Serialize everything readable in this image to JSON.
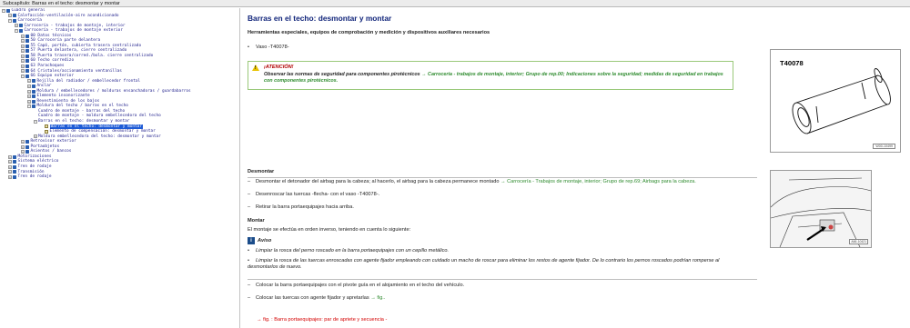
{
  "window": {
    "title": "Subcapítulo: Barras en el techo: desmontar y montar"
  },
  "tree": [
    {
      "indent": 0,
      "exp": "−",
      "icon": "book",
      "label": "Cuadro general"
    },
    {
      "indent": 1,
      "exp": "+",
      "icon": "book",
      "label": "Calefacción-ventilación-aire acondicionado"
    },
    {
      "indent": 1,
      "exp": "−",
      "icon": "book",
      "label": "Carrocería"
    },
    {
      "indent": 2,
      "exp": "+",
      "icon": "book",
      "label": "Carrocería - trabajos de montaje, interior"
    },
    {
      "indent": 2,
      "exp": "−",
      "icon": "book",
      "label": "Carrocería - trabajos de montaje exterior"
    },
    {
      "indent": 3,
      "exp": "+",
      "icon": "book",
      "label": "00 Datos técnicos"
    },
    {
      "indent": 3,
      "exp": "+",
      "icon": "book",
      "label": "50 Carrocería parte delantera"
    },
    {
      "indent": 3,
      "exp": "+",
      "icon": "book",
      "label": "55 Capó, portón, cubierta trasera centralizado"
    },
    {
      "indent": 3,
      "exp": "+",
      "icon": "book",
      "label": "57 Puerta delantera, cierre centralizado"
    },
    {
      "indent": 3,
      "exp": "+",
      "icon": "book",
      "label": "58 Puerta trasera/corred./bola. cierre centralizado"
    },
    {
      "indent": 3,
      "exp": "+",
      "icon": "book",
      "label": "60 Techo corredizo"
    },
    {
      "indent": 3,
      "exp": "+",
      "icon": "book",
      "label": "63 Parachoques"
    },
    {
      "indent": 3,
      "exp": "+",
      "icon": "book",
      "label": "64 Cristales/accionamiento ventanillas"
    },
    {
      "indent": 3,
      "exp": "−",
      "icon": "book",
      "label": "66 Equipo exterior"
    },
    {
      "indent": 4,
      "exp": "+",
      "icon": "book",
      "label": "Rejilla del radiador / embellecedor frontal"
    },
    {
      "indent": 4,
      "exp": "+",
      "icon": "book",
      "label": "Anclar"
    },
    {
      "indent": 4,
      "exp": "+",
      "icon": "book",
      "label": "Moldura / embellecedores / molduras ensanchadoras / guardabarros"
    },
    {
      "indent": 4,
      "exp": "+",
      "icon": "book",
      "label": "Elemento insonorizante"
    },
    {
      "indent": 4,
      "exp": "+",
      "icon": "book",
      "label": "Revestimiento de los bajos"
    },
    {
      "indent": 4,
      "exp": "−",
      "icon": "book",
      "label": "Moldura del techo / barras en el techo"
    },
    {
      "indent": 5,
      "exp": "",
      "icon": "doc",
      "label": "Cuadro de montaje - barras del techo"
    },
    {
      "indent": 5,
      "exp": "",
      "icon": "doc",
      "label": "Cuadro de montaje - moldura embellecedora del techo"
    },
    {
      "indent": 5,
      "exp": "−",
      "icon": "doc",
      "label": "Barras en el techo: desmontar y montar"
    },
    {
      "indent": 6,
      "exp": "",
      "icon": "page",
      "label": "Barras en el techo: desmontar y montar",
      "selected": true
    },
    {
      "indent": 6,
      "exp": "",
      "icon": "page",
      "label": "Elemento de compensación: desmontar y montar"
    },
    {
      "indent": 5,
      "exp": "+",
      "icon": "doc",
      "label": "Moldura embellecedora del techo: desmontar y montar"
    },
    {
      "indent": 3,
      "exp": "+",
      "icon": "book",
      "label": "Retrovisor exterior"
    },
    {
      "indent": 3,
      "exp": "+",
      "icon": "book",
      "label": "Portaobjetos"
    },
    {
      "indent": 3,
      "exp": "+",
      "icon": "book",
      "label": "Asientos / bancos"
    },
    {
      "indent": 1,
      "exp": "+",
      "icon": "book",
      "label": "Motorizaciones"
    },
    {
      "indent": 1,
      "exp": "+",
      "icon": "book",
      "label": "Sistema eléctrico"
    },
    {
      "indent": 1,
      "exp": "+",
      "icon": "book",
      "label": "Tren de rodaje"
    },
    {
      "indent": 1,
      "exp": "+",
      "icon": "book",
      "label": "Transmisión"
    },
    {
      "indent": 1,
      "exp": "+",
      "icon": "book",
      "label": "Tren de rodaje"
    }
  ],
  "doc": {
    "title": "Barras en el techo: desmontar y montar",
    "subtitle": "Herramientas especiales, equipos de comprobación y medición y dispositivos auxiliares necesarios",
    "tool_bullet": "Vaso -T40078-",
    "warning": {
      "title": "¡ATENCIÓN!",
      "text_prefix": "Observar las normas de seguridad para componentes pirotécnicos ",
      "link": "→ Carrocería - trabajos de montaje, interior; Grupo de rep.00; Indicaciones sobre la seguridad; medidas de seguridad en trabajos con componentes pirotécnicos."
    },
    "figure1": {
      "label": "T40078",
      "code": "W00-10499"
    },
    "figure2": {
      "code": "A66-10421"
    },
    "desmontar": {
      "heading": "Desmontar",
      "steps": [
        {
          "text": "Desmontar el detonador del airbag para la cabeza; al hacerlo, el airbag para la cabeza permanece montado ",
          "link": "→ Carrocería - Trabajos de montaje, interior; Grupo de rep.69; Airbags para la cabeza."
        },
        {
          "text": "Desenroscar las tuercas -flecha- con el vaso -T40078-.",
          "link": ""
        },
        {
          "text": "Retirar la barra portaequipajes hacia arriba.",
          "link": ""
        }
      ]
    },
    "montar": {
      "heading": "Montar",
      "intro": "El montaje se efectúa en orden inverso, teniendo en cuenta lo siguiente:",
      "aviso_label": "Aviso",
      "aviso_items": [
        "Limpiar la rosca del perno roscado en la barra portaequipajes con un cepillo metálico.",
        "Limpiar la rosca de las tuercas enroscadas con agente fijador empleando con cuidado un macho de roscar para eliminar los restos de agente fijador. De lo contrario los pernos roscados podrían romperse al desmontarlos de nuevo."
      ],
      "steps": [
        {
          "text": "Colocar la barra portaequipajes con el pivote guía en el alojamiento en el techo del vehículo.",
          "link": ""
        },
        {
          "text": "Colocar las tuercas con agente fijador y apretarlas ",
          "link": "→ fig.."
        }
      ],
      "footer": "→ fig. : Barra portaequipajes: par de apriete y secuencia -"
    }
  }
}
